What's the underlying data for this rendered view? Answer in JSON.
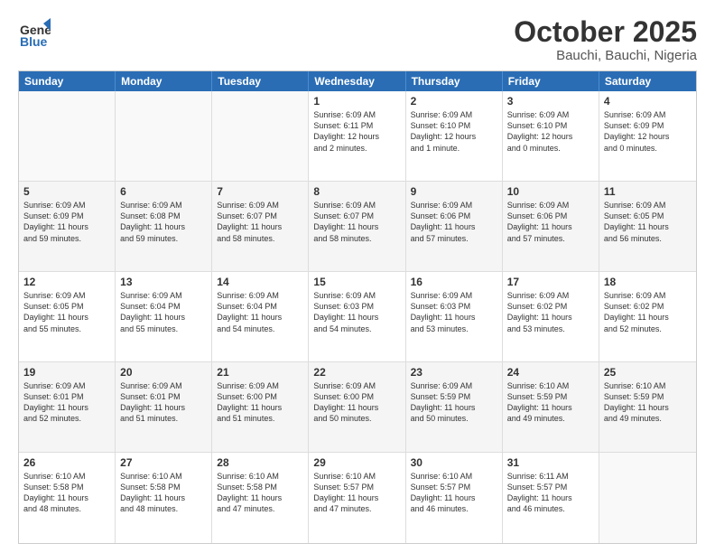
{
  "header": {
    "logo_general": "General",
    "logo_blue": "Blue",
    "month_title": "October 2025",
    "location": "Bauchi, Bauchi, Nigeria"
  },
  "days_of_week": [
    "Sunday",
    "Monday",
    "Tuesday",
    "Wednesday",
    "Thursday",
    "Friday",
    "Saturday"
  ],
  "weeks": [
    [
      {
        "day": "",
        "lines": []
      },
      {
        "day": "",
        "lines": []
      },
      {
        "day": "",
        "lines": []
      },
      {
        "day": "1",
        "lines": [
          "Sunrise: 6:09 AM",
          "Sunset: 6:11 PM",
          "Daylight: 12 hours",
          "and 2 minutes."
        ]
      },
      {
        "day": "2",
        "lines": [
          "Sunrise: 6:09 AM",
          "Sunset: 6:10 PM",
          "Daylight: 12 hours",
          "and 1 minute."
        ]
      },
      {
        "day": "3",
        "lines": [
          "Sunrise: 6:09 AM",
          "Sunset: 6:10 PM",
          "Daylight: 12 hours",
          "and 0 minutes."
        ]
      },
      {
        "day": "4",
        "lines": [
          "Sunrise: 6:09 AM",
          "Sunset: 6:09 PM",
          "Daylight: 12 hours",
          "and 0 minutes."
        ]
      }
    ],
    [
      {
        "day": "5",
        "lines": [
          "Sunrise: 6:09 AM",
          "Sunset: 6:09 PM",
          "Daylight: 11 hours",
          "and 59 minutes."
        ]
      },
      {
        "day": "6",
        "lines": [
          "Sunrise: 6:09 AM",
          "Sunset: 6:08 PM",
          "Daylight: 11 hours",
          "and 59 minutes."
        ]
      },
      {
        "day": "7",
        "lines": [
          "Sunrise: 6:09 AM",
          "Sunset: 6:07 PM",
          "Daylight: 11 hours",
          "and 58 minutes."
        ]
      },
      {
        "day": "8",
        "lines": [
          "Sunrise: 6:09 AM",
          "Sunset: 6:07 PM",
          "Daylight: 11 hours",
          "and 58 minutes."
        ]
      },
      {
        "day": "9",
        "lines": [
          "Sunrise: 6:09 AM",
          "Sunset: 6:06 PM",
          "Daylight: 11 hours",
          "and 57 minutes."
        ]
      },
      {
        "day": "10",
        "lines": [
          "Sunrise: 6:09 AM",
          "Sunset: 6:06 PM",
          "Daylight: 11 hours",
          "and 57 minutes."
        ]
      },
      {
        "day": "11",
        "lines": [
          "Sunrise: 6:09 AM",
          "Sunset: 6:05 PM",
          "Daylight: 11 hours",
          "and 56 minutes."
        ]
      }
    ],
    [
      {
        "day": "12",
        "lines": [
          "Sunrise: 6:09 AM",
          "Sunset: 6:05 PM",
          "Daylight: 11 hours",
          "and 55 minutes."
        ]
      },
      {
        "day": "13",
        "lines": [
          "Sunrise: 6:09 AM",
          "Sunset: 6:04 PM",
          "Daylight: 11 hours",
          "and 55 minutes."
        ]
      },
      {
        "day": "14",
        "lines": [
          "Sunrise: 6:09 AM",
          "Sunset: 6:04 PM",
          "Daylight: 11 hours",
          "and 54 minutes."
        ]
      },
      {
        "day": "15",
        "lines": [
          "Sunrise: 6:09 AM",
          "Sunset: 6:03 PM",
          "Daylight: 11 hours",
          "and 54 minutes."
        ]
      },
      {
        "day": "16",
        "lines": [
          "Sunrise: 6:09 AM",
          "Sunset: 6:03 PM",
          "Daylight: 11 hours",
          "and 53 minutes."
        ]
      },
      {
        "day": "17",
        "lines": [
          "Sunrise: 6:09 AM",
          "Sunset: 6:02 PM",
          "Daylight: 11 hours",
          "and 53 minutes."
        ]
      },
      {
        "day": "18",
        "lines": [
          "Sunrise: 6:09 AM",
          "Sunset: 6:02 PM",
          "Daylight: 11 hours",
          "and 52 minutes."
        ]
      }
    ],
    [
      {
        "day": "19",
        "lines": [
          "Sunrise: 6:09 AM",
          "Sunset: 6:01 PM",
          "Daylight: 11 hours",
          "and 52 minutes."
        ]
      },
      {
        "day": "20",
        "lines": [
          "Sunrise: 6:09 AM",
          "Sunset: 6:01 PM",
          "Daylight: 11 hours",
          "and 51 minutes."
        ]
      },
      {
        "day": "21",
        "lines": [
          "Sunrise: 6:09 AM",
          "Sunset: 6:00 PM",
          "Daylight: 11 hours",
          "and 51 minutes."
        ]
      },
      {
        "day": "22",
        "lines": [
          "Sunrise: 6:09 AM",
          "Sunset: 6:00 PM",
          "Daylight: 11 hours",
          "and 50 minutes."
        ]
      },
      {
        "day": "23",
        "lines": [
          "Sunrise: 6:09 AM",
          "Sunset: 5:59 PM",
          "Daylight: 11 hours",
          "and 50 minutes."
        ]
      },
      {
        "day": "24",
        "lines": [
          "Sunrise: 6:10 AM",
          "Sunset: 5:59 PM",
          "Daylight: 11 hours",
          "and 49 minutes."
        ]
      },
      {
        "day": "25",
        "lines": [
          "Sunrise: 6:10 AM",
          "Sunset: 5:59 PM",
          "Daylight: 11 hours",
          "and 49 minutes."
        ]
      }
    ],
    [
      {
        "day": "26",
        "lines": [
          "Sunrise: 6:10 AM",
          "Sunset: 5:58 PM",
          "Daylight: 11 hours",
          "and 48 minutes."
        ]
      },
      {
        "day": "27",
        "lines": [
          "Sunrise: 6:10 AM",
          "Sunset: 5:58 PM",
          "Daylight: 11 hours",
          "and 48 minutes."
        ]
      },
      {
        "day": "28",
        "lines": [
          "Sunrise: 6:10 AM",
          "Sunset: 5:58 PM",
          "Daylight: 11 hours",
          "and 47 minutes."
        ]
      },
      {
        "day": "29",
        "lines": [
          "Sunrise: 6:10 AM",
          "Sunset: 5:57 PM",
          "Daylight: 11 hours",
          "and 47 minutes."
        ]
      },
      {
        "day": "30",
        "lines": [
          "Sunrise: 6:10 AM",
          "Sunset: 5:57 PM",
          "Daylight: 11 hours",
          "and 46 minutes."
        ]
      },
      {
        "day": "31",
        "lines": [
          "Sunrise: 6:11 AM",
          "Sunset: 5:57 PM",
          "Daylight: 11 hours",
          "and 46 minutes."
        ]
      },
      {
        "day": "",
        "lines": []
      }
    ]
  ]
}
